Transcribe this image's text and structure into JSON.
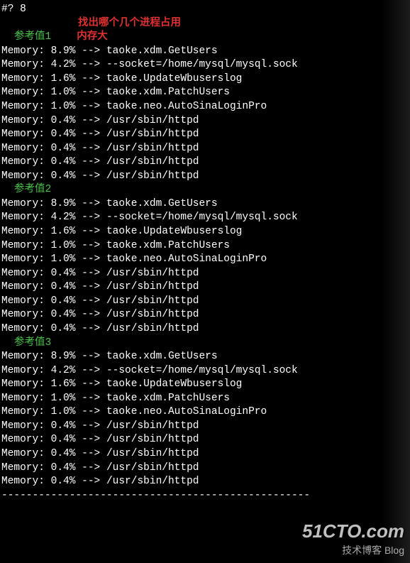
{
  "prompt": "#? 8",
  "title_line1": "找出哪个几个进程占用",
  "title_line2": "内存大",
  "sections": [
    {
      "label": "参考值1"
    },
    {
      "label": "参考值2"
    },
    {
      "label": "参考值3"
    }
  ],
  "rows": [
    {
      "label": "Memory:",
      "pct": "8.9%",
      "arrow": "-->",
      "cmd": "taoke.xdm.GetUsers"
    },
    {
      "label": "Memory:",
      "pct": "4.2%",
      "arrow": "-->",
      "cmd": "--socket=/home/mysql/mysql.sock"
    },
    {
      "label": "Memory:",
      "pct": "1.6%",
      "arrow": "-->",
      "cmd": "taoke.UpdateWbuserslog"
    },
    {
      "label": "Memory:",
      "pct": "1.0%",
      "arrow": "-->",
      "cmd": "taoke.xdm.PatchUsers"
    },
    {
      "label": "Memory:",
      "pct": "1.0%",
      "arrow": "-->",
      "cmd": "taoke.neo.AutoSinaLoginPro"
    },
    {
      "label": "Memory:",
      "pct": "0.4%",
      "arrow": "-->",
      "cmd": "/usr/sbin/httpd"
    },
    {
      "label": "Memory:",
      "pct": "0.4%",
      "arrow": "-->",
      "cmd": "/usr/sbin/httpd"
    },
    {
      "label": "Memory:",
      "pct": "0.4%",
      "arrow": "-->",
      "cmd": "/usr/sbin/httpd"
    },
    {
      "label": "Memory:",
      "pct": "0.4%",
      "arrow": "-->",
      "cmd": "/usr/sbin/httpd"
    },
    {
      "label": "Memory:",
      "pct": "0.4%",
      "arrow": "-->",
      "cmd": "/usr/sbin/httpd"
    }
  ],
  "divider": "--------------------------------------------------",
  "watermark": {
    "brand": "51CTO.com",
    "sub": "技术博客  Blog"
  }
}
